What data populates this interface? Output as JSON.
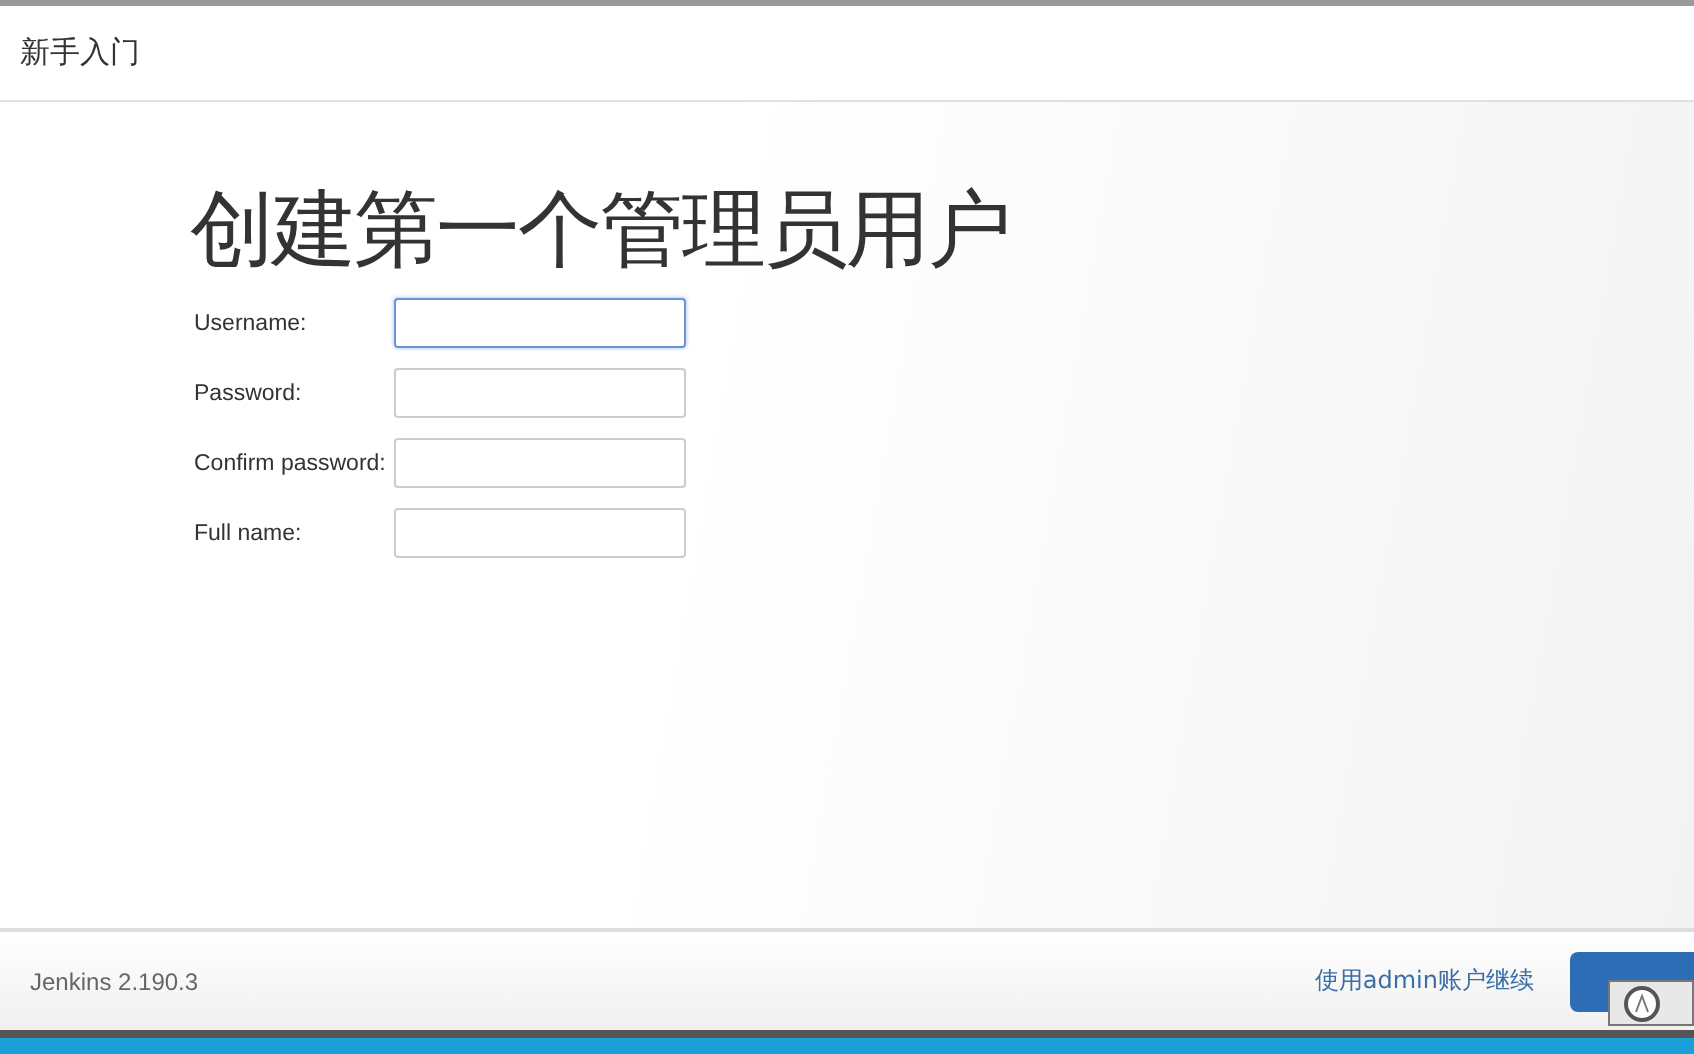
{
  "header": {
    "title": "新手入门"
  },
  "heading": "创建第一个管理员用户",
  "fields": [
    {
      "label": "Username:",
      "focused": true
    },
    {
      "label": "Password:",
      "focused": false
    },
    {
      "label": "Confirm password:",
      "focused": false
    },
    {
      "label": "Full name:",
      "focused": false
    }
  ],
  "footer": {
    "version": "Jenkins 2.190.3",
    "link": "使用admin账户继续"
  }
}
